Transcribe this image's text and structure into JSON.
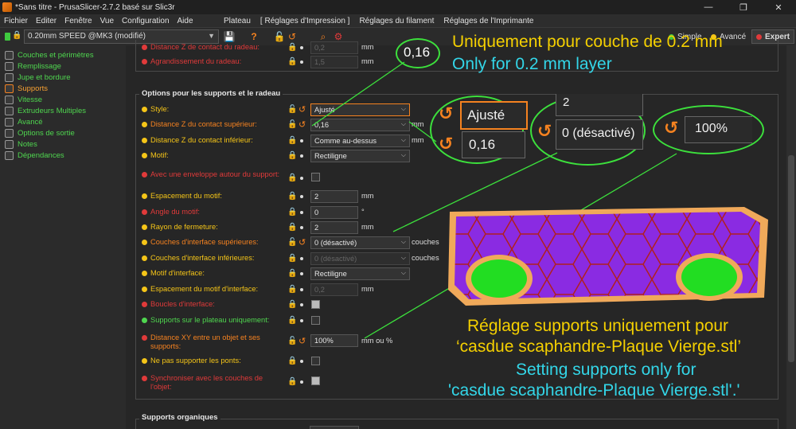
{
  "window": {
    "title": "*Sans titre - PrusaSlicer-2.7.2 basé sur Slic3r",
    "minimize": "—",
    "maximize": "❐",
    "close": "✕"
  },
  "menu": {
    "items": [
      "Fichier",
      "Editer",
      "Fenêtre",
      "Vue",
      "Configuration",
      "Aide"
    ],
    "tabs": [
      "Plateau",
      "[ Réglages d'Impression ]",
      "Réglages du filament",
      "Réglages de l'Imprimante"
    ]
  },
  "toolbar": {
    "preset": "0.20mm SPEED @MK3 (modifié)",
    "modes": [
      {
        "label": "Simple",
        "color": "#3fc93f"
      },
      {
        "label": "Avancé",
        "color": "#f5c518"
      },
      {
        "label": "Expert",
        "color": "#e03a3a"
      }
    ]
  },
  "sidebar": {
    "items": [
      {
        "label": "Couches et périmètres",
        "active": false
      },
      {
        "label": "Remplissage",
        "active": false
      },
      {
        "label": "Jupe et bordure",
        "active": false
      },
      {
        "label": "Supports",
        "active": true
      },
      {
        "label": "Vitesse",
        "active": false
      },
      {
        "label": "Extrudeurs Multiples",
        "active": false
      },
      {
        "label": "Avancé",
        "active": false
      },
      {
        "label": "Options de sortie",
        "active": false
      },
      {
        "label": "Notes",
        "active": false
      },
      {
        "label": "Dépendances",
        "active": false
      }
    ]
  },
  "top_rows": [
    {
      "label": "Distance Z de contact du radeau:",
      "value": "0,2",
      "unit": "mm"
    },
    {
      "label": "Agrandissement du radeau:",
      "value": "1,5",
      "unit": "mm"
    }
  ],
  "support_group": {
    "title": "Options pour les supports et le radeau",
    "rows": [
      {
        "label": "Style:",
        "value": "Ajusté",
        "unit": ""
      },
      {
        "label": "Distance Z du contact supérieur:",
        "value": "0,16",
        "unit": "mm"
      },
      {
        "label": "Distance Z du contact inférieur:",
        "value": "Comme au-dessus",
        "unit": "mm"
      },
      {
        "label": "Motif:",
        "value": "Rectiligne",
        "unit": ""
      },
      {
        "label": "Avec une enveloppe autour du support:",
        "value": "",
        "unit": ""
      },
      {
        "label": "Espacement du motif:",
        "value": "2",
        "unit": "mm"
      },
      {
        "label": "Angle du motif:",
        "value": "0",
        "unit": "°"
      },
      {
        "label": "Rayon de fermeture:",
        "value": "2",
        "unit": "mm"
      },
      {
        "label": "Couches d'interface supérieures:",
        "value": "0 (désactivé)",
        "unit": "couches"
      },
      {
        "label": "Couches d'interface inférieures:",
        "value": "0 (désactivé)",
        "unit": "couches"
      },
      {
        "label": "Motif d'interface:",
        "value": "Rectiligne",
        "unit": ""
      },
      {
        "label": "Espacement du motif d'interface:",
        "value": "0,2",
        "unit": "mm"
      },
      {
        "label": "Boucles d'interface:",
        "value": "",
        "unit": ""
      },
      {
        "label": "Supports sur le plateau uniquement:",
        "value": "",
        "unit": ""
      },
      {
        "label": "Distance XY entre un objet et ses supports:",
        "value": "100%",
        "unit": "mm ou %"
      },
      {
        "label": "Ne pas supporter les ponts:",
        "value": "",
        "unit": ""
      },
      {
        "label": "Synchroniser avec les couches de l'objet:",
        "value": "",
        "unit": ""
      }
    ]
  },
  "organic_group": {
    "title": "Supports organiques"
  },
  "annotations": {
    "fr_layer": "Uniquement pour couche de 0.2 mm",
    "en_layer": "Only for 0.2 mm layer",
    "fr_setting_1": "Réglage supports uniquement pour",
    "fr_setting_2": "‘casdue scaphandre-Plaque Vierge.stl’",
    "en_setting_1": "Setting supports only for",
    "en_setting_2": "'casdue scaphandre-Plaque Vierge.stl'.'",
    "zoom_016": "0,16",
    "zoom_style": "Ajusté",
    "zoom_016b": "0,16",
    "zoom_interface": "0 (désactivé)",
    "zoom_top_partial": "2",
    "zoom_xy": "100%"
  },
  "colors": {
    "accent_orange": "#f58220",
    "annotation_yellow": "#f5d000",
    "annotation_cyan": "#33d6e8",
    "circle_green": "#3ce03c",
    "plate_purple": "#8a2be2"
  }
}
